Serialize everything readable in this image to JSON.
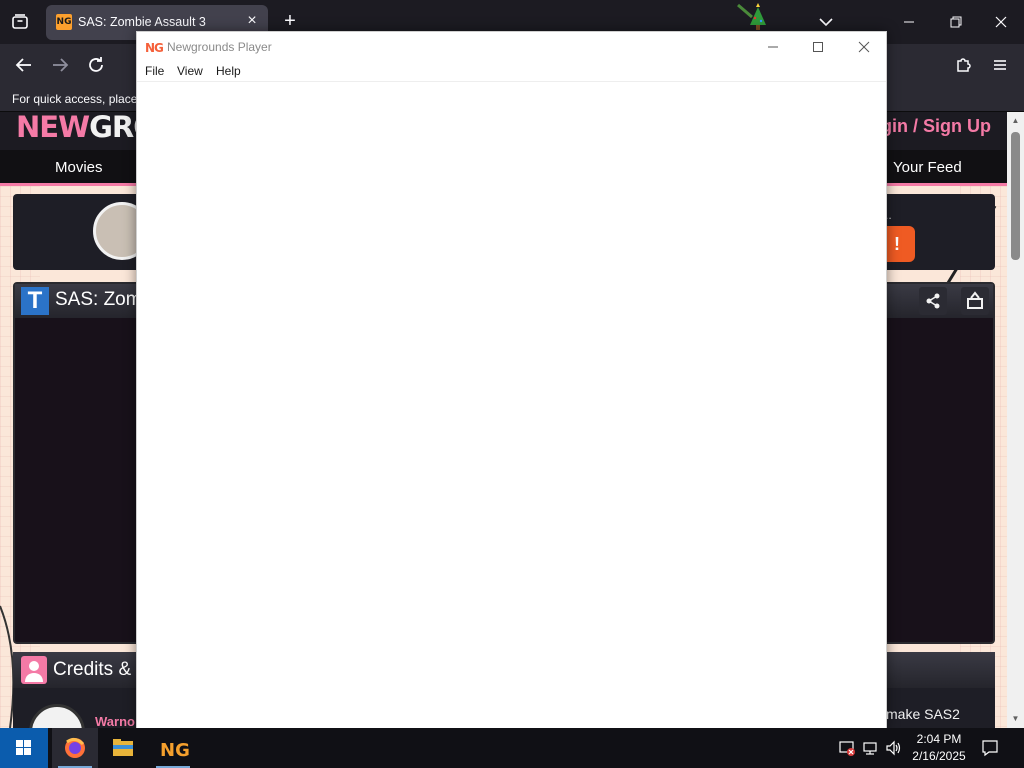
{
  "browser": {
    "tab_title": "SAS: Zombie Assault 3",
    "tab_favicon_text": "NG",
    "bookmarks_hint": "For quick access, place y"
  },
  "page": {
    "logo_part_a": "NEW",
    "logo_part_b": "GROU",
    "login_link": "gin / Sign Up",
    "nav_items": [
      "Movies",
      "Your Feed"
    ],
    "ad_button": "!",
    "ad_dots": "..",
    "game_title": "SAS: Zomb",
    "credits_title": "Credits & I",
    "credit_author": "Warno",
    "credit_desc": "make SAS2"
  },
  "player": {
    "title": "Newgrounds Player",
    "icon_text": "NG",
    "menu": [
      "File",
      "View",
      "Help"
    ]
  },
  "taskbar": {
    "time": "2:04 PM",
    "date": "2/16/2025",
    "ng_app_text": "NG"
  },
  "colors": {
    "ng_pink": "#f47aa6",
    "ng_orange": "#fda02d",
    "taskbar": "#101015",
    "firefox_chrome": "#2b2a33"
  }
}
